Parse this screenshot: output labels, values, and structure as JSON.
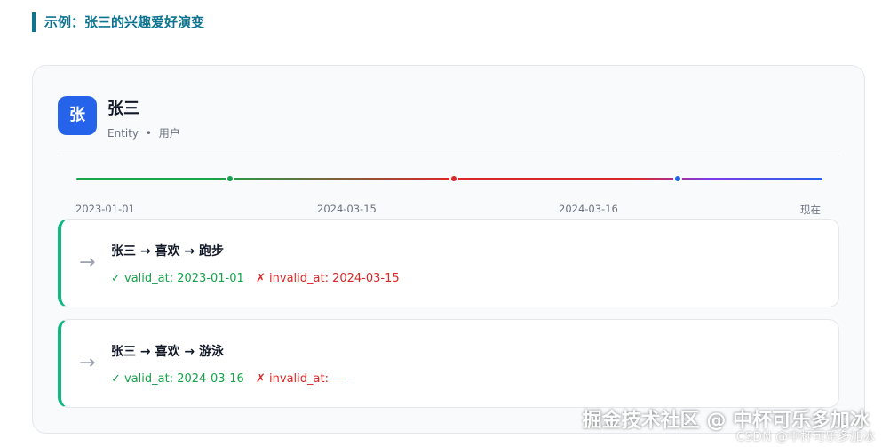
{
  "section_title": "示例：张三的兴趣爱好演变",
  "entity": {
    "avatar_text": "张",
    "name": "张三",
    "type": "Entity",
    "separator": "•",
    "category": "用户"
  },
  "timeline": {
    "labels": [
      "2023-01-01",
      "2024-03-15",
      "2024-03-16",
      "现在"
    ],
    "colors": {
      "green": "#16a34a",
      "red": "#dc2626",
      "blue": "#2563eb"
    }
  },
  "facts": [
    {
      "arrow": "→",
      "triple": "张三 → 喜欢 → 跑步",
      "valid": "✓ valid_at: 2023-01-01",
      "invalid": "✗ invalid_at: 2024-03-15"
    },
    {
      "arrow": "→",
      "triple": "张三 → 喜欢 → 游泳",
      "valid": "✓ valid_at: 2024-03-16",
      "invalid": "✗ invalid_at: —"
    }
  ],
  "watermark": {
    "main": "掘金技术社区 @ 中杯可乐多加冰",
    "small": "CSDN @中杯可乐多加冰"
  }
}
